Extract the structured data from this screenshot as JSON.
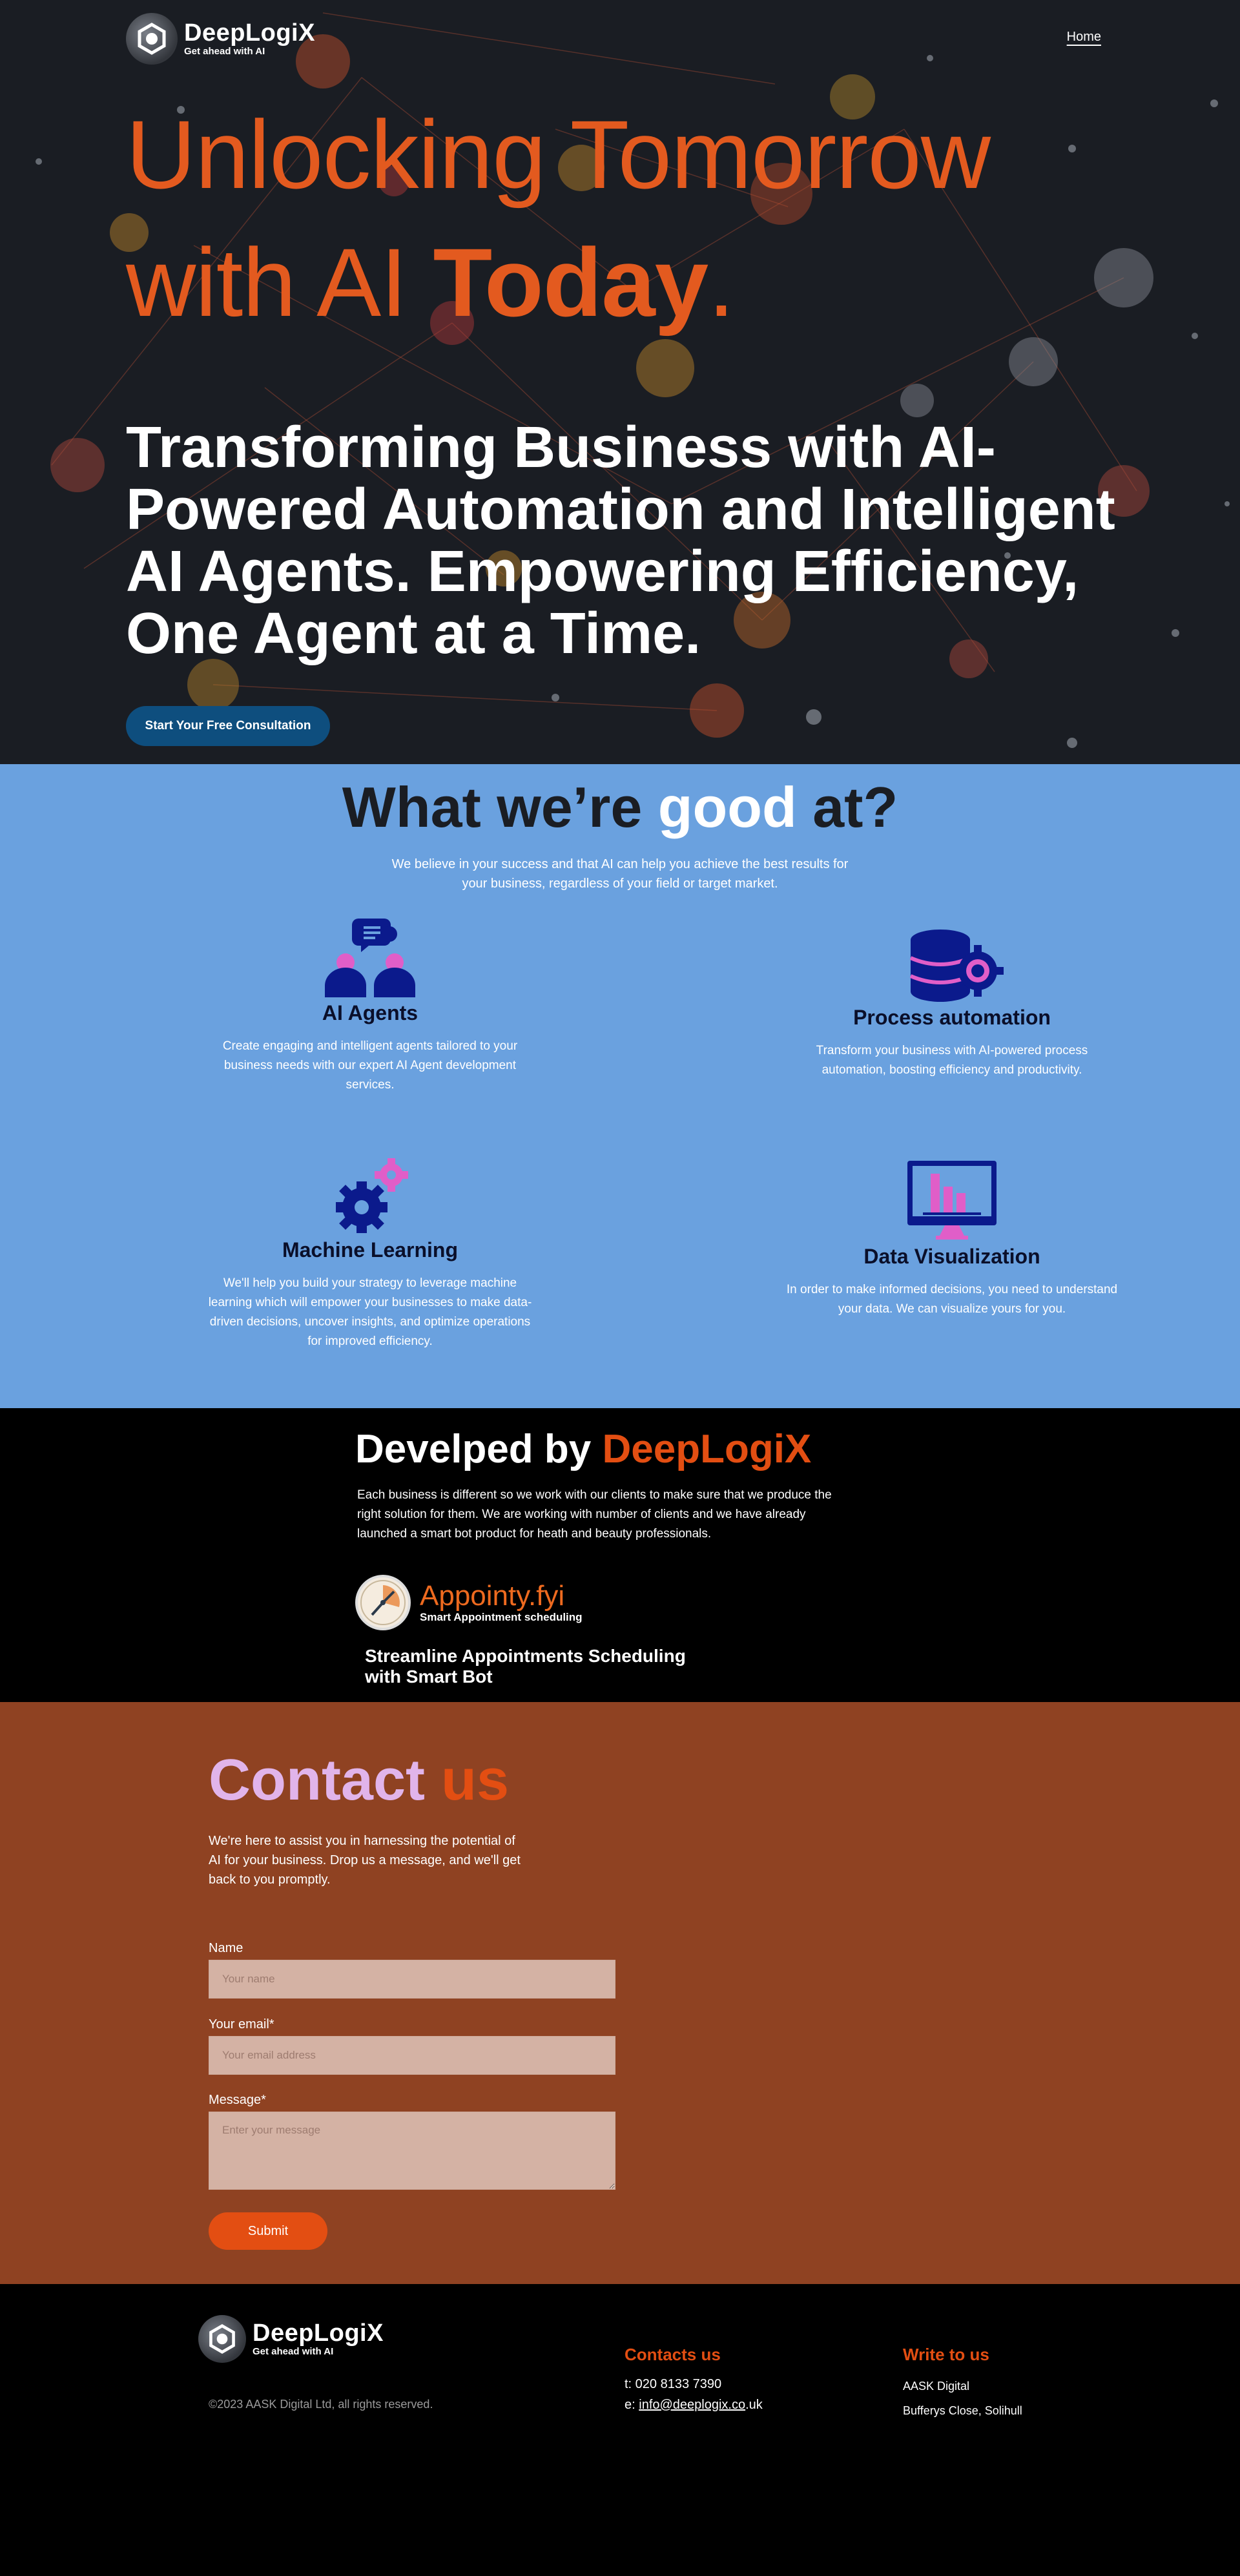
{
  "nav": {
    "brand_name": "DeepLogiX",
    "brand_tagline": "Get ahead with AI",
    "home_link": "Home"
  },
  "hero": {
    "title_line1": "Unlocking Tomorrow",
    "title_line2_start": "with AI ",
    "title_line2_bold": "Today",
    "title_line2_end": ".",
    "subtitle": "Transforming Business with AI-Powered Automation and Intelligent AI Agents. Empowering Efficiency, One Agent at a Time.",
    "cta_label": "Start Your Free Consultation"
  },
  "services": {
    "heading_start": "What we’re ",
    "heading_highlight": "good",
    "heading_end": " at?",
    "intro": "We believe in your success and that AI can help you achieve the best results for your business, regardless of your field or target market.",
    "items": [
      {
        "icon": "ai-agents-icon",
        "title": "AI Agents",
        "text": "Create engaging and intelligent agents tailored to your business needs with our expert AI Agent development services."
      },
      {
        "icon": "database-gear-icon",
        "title": "Process automation",
        "text": "Transform your business with AI-powered process automation, boosting efficiency and productivity."
      },
      {
        "icon": "gears-icon",
        "title": "Machine Learning",
        "text": "We'll help you build your strategy to leverage machine learning which will empower your businesses to make data-driven decisions, uncover insights, and optimize operations for improved efficiency."
      },
      {
        "icon": "monitor-chart-icon",
        "title": "Data Visualization",
        "text": "In order to make informed decisions, you need to understand your data. We can visualize yours for you."
      }
    ]
  },
  "developed": {
    "heading_start": "Develped by ",
    "heading_highlight": "DeepLogiX",
    "description": "Each business is different so we work with our clients to make sure that we produce the right solution for them. We are working with number of clients and we have already launched a smart bot product for heath and beauty professionals.",
    "product_name": "Appointy.fyi",
    "product_tagline": "Smart Appointment scheduling",
    "product_headline": "Streamline Appointments Scheduling with Smart Bot"
  },
  "contact": {
    "heading_start": "Contact ",
    "heading_highlight": "us",
    "intro": "We're here to assist you in harnessing the potential of AI for your business. Drop us a message, and we'll get back to you promptly.",
    "name_label": "Name",
    "name_placeholder": "Your name",
    "email_label": "Your email*",
    "email_placeholder": "Your email address",
    "message_label": "Message*",
    "message_placeholder": "Enter your message",
    "submit_label": "Submit"
  },
  "footer": {
    "brand_name": "DeepLogiX",
    "brand_tagline": "Get ahead with AI",
    "copyright": "©2023 AASK Digital Ltd, all rights reserved.",
    "contacts_heading": "Contacts us",
    "phone": "t: 020 8133 7390",
    "email_prefix": "e: ",
    "email_link": "info@deeplogix.co",
    "email_suffix": ".uk",
    "write_heading": "Write to us",
    "address_line1": "AASK Digital",
    "address_line2": "Bufferys Close, Solihull"
  },
  "colors": {
    "accent_orange": "#e34e12",
    "services_bg": "#6aa1df",
    "contact_bg": "#8f4222",
    "cta_blue": "#0e4e7e",
    "icon_navy": "#0b1a8c",
    "icon_pink": "#e05ec8"
  }
}
